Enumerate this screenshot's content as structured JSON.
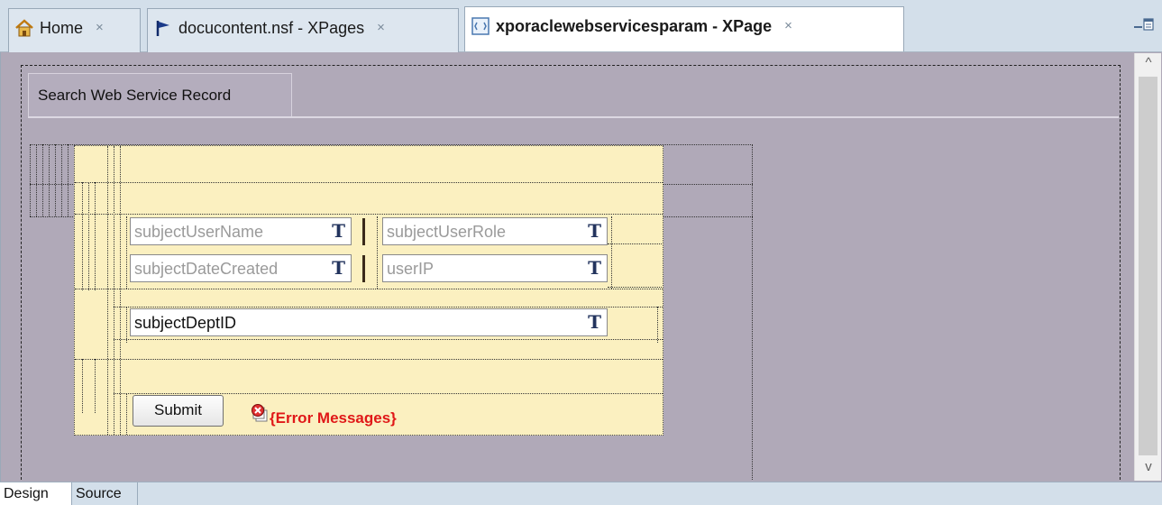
{
  "tabs": [
    {
      "label": "Home",
      "icon": "home-icon",
      "close": "×"
    },
    {
      "label": "docucontent.nsf - XPages",
      "icon": "flag-icon",
      "close": "×"
    },
    {
      "label": "xporaclewebservicesparam - XPage",
      "icon": "xpage-icon",
      "close": "×",
      "active": true
    }
  ],
  "section": {
    "title": "Search Web Service Record"
  },
  "fields": {
    "subjectUserName": {
      "placeholder": "subjectUserName",
      "icon": "T"
    },
    "subjectUserRole": {
      "placeholder": "subjectUserRole",
      "icon": "T"
    },
    "subjectDateCreated": {
      "placeholder": "subjectDateCreated",
      "icon": "T"
    },
    "userIP": {
      "placeholder": "userIP",
      "icon": "T"
    },
    "subjectDeptID": {
      "value": "subjectDeptID",
      "icon": "T"
    }
  },
  "actions": {
    "submit_label": "Submit"
  },
  "error": {
    "label": "{Error Messages}"
  },
  "scroll": {
    "up": "^",
    "down": "v"
  },
  "bottom_tabs": [
    {
      "label": "Design",
      "active": true
    },
    {
      "label": "Source"
    }
  ],
  "colors": {
    "canvas": "#b0a9b8",
    "panel": "#fbf0c0",
    "error": "#e01818",
    "tabbar": "#d3dfea"
  }
}
